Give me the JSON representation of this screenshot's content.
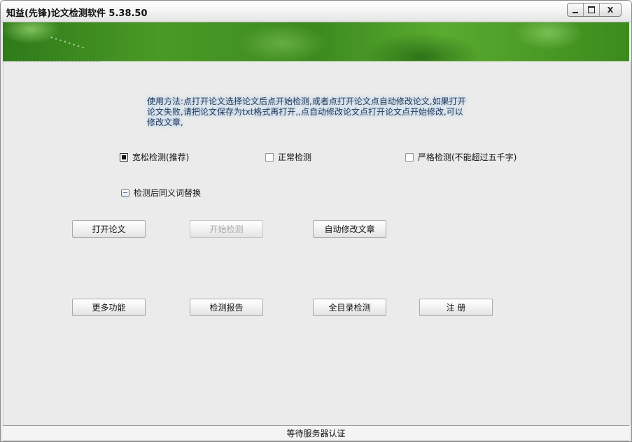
{
  "window": {
    "title": "知益(先锋)论文检测软件 5.38.50",
    "controls": {
      "minimize": "",
      "maximize": "",
      "close": "X"
    }
  },
  "instructions": "使用方法:点打开论文选择论文后点开始检测,或者点打开论文点自动修改论文,如果打开论文失败,请把论文保存为txt格式再打开,,点自动修改论文点打开论文点开始修改,可以修改文章,",
  "modes": [
    {
      "label": "宽松检测(推荐)",
      "checked": true
    },
    {
      "label": "正常检测",
      "checked": false
    },
    {
      "label": "严格检测(不能超过五千字)",
      "checked": false
    }
  ],
  "synonym_option": {
    "label": "检测后同义词替换",
    "checked": false
  },
  "buttons": {
    "open": "打开论文",
    "start": "开始检测",
    "auto_modify": "自动修改文章",
    "more": "更多功能",
    "report": "检测报告",
    "full_catalog": "全目录检测",
    "register": "注 册"
  },
  "status": "等待服务器认证",
  "colors": {
    "banner_green": "#3c8a1f",
    "instruction_glow": "#9fc6ea",
    "disabled_text": "#a8a8a8"
  }
}
